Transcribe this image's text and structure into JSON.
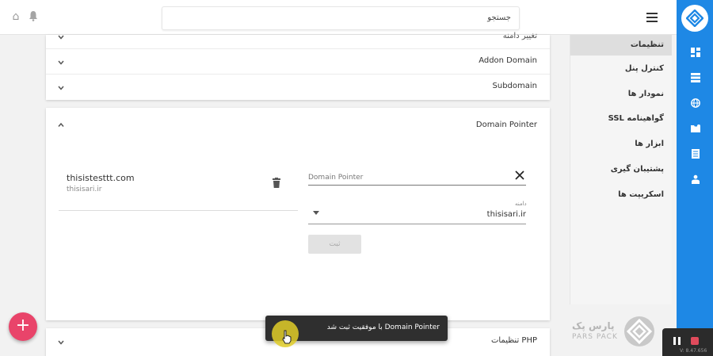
{
  "search": {
    "value": "جستجو"
  },
  "menu": {
    "items": [
      {
        "label": "تنظیمات",
        "active": true
      },
      {
        "label": "کنترل پنل"
      },
      {
        "label": "نمودار ها"
      },
      {
        "label": "گواهینامه SSL"
      },
      {
        "label": "ابزار ها"
      },
      {
        "label": "پشتیبان گیری"
      },
      {
        "label": "اسکریپت ها"
      }
    ]
  },
  "rail": {
    "accent": "#1e88e5",
    "icons": [
      "dashboard-icon",
      "server-icon",
      "globe-icon",
      "folder-icon",
      "document-icon",
      "users-icon"
    ]
  },
  "panels": {
    "top_rows": [
      {
        "label": "تغییر دامنه"
      },
      {
        "label": "Addon Domain"
      },
      {
        "label": "Subdomain"
      }
    ],
    "domain_pointer": {
      "title": "Domain Pointer",
      "entry": {
        "domain": "thisistesttt.com",
        "parent": "thisisari.ir"
      },
      "input_placeholder": "Domain Pointer",
      "select_caption": "دامنه",
      "select_value": "thisisari.ir",
      "submit_label": "ثبت"
    },
    "php_row": {
      "label": "تنظیمات PHP"
    }
  },
  "snackbar": {
    "message": "Domain Pointer با موفقیت ثبت شد"
  },
  "fab": {
    "label": "+",
    "color": "#e9446a"
  },
  "watermark": {
    "line1": "پارس پک",
    "line2": "PARS PACK"
  },
  "recorder": {
    "version": "V: 8.47.656"
  }
}
